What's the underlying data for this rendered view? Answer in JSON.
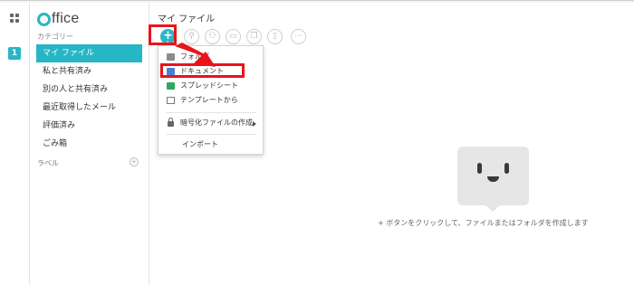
{
  "app": {
    "logo_text": "ffice"
  },
  "rail": {
    "badge": "1"
  },
  "sidebar": {
    "category_label": "カテゴリー",
    "items": [
      {
        "label": "マイ ファイル",
        "active": true
      },
      {
        "label": "私と共有済み"
      },
      {
        "label": "別の人と共有済み"
      },
      {
        "label": "最近取得したメール"
      },
      {
        "label": "評価済み"
      },
      {
        "label": "ごみ箱"
      }
    ],
    "labels_heading": "ラベル",
    "add_label_icon": "+"
  },
  "main": {
    "title": "マイ ファイル",
    "toolbar": {
      "new_icon": "+",
      "link_icon": "⚲",
      "share_icon": "⚇",
      "folder_icon": "▭",
      "copy_icon": "❐",
      "delete_icon": "▯",
      "more_icon": "⋯"
    }
  },
  "menu": {
    "items": [
      {
        "label": "フォルダ",
        "icon": "folder-icon"
      },
      {
        "label": "ドキュメント",
        "icon": "document-icon"
      },
      {
        "label": "スプレッドシート",
        "icon": "spreadsheet-icon"
      },
      {
        "label": "テンプレートから",
        "icon": "template-icon"
      },
      {
        "label": "暗号化ファイルの作成",
        "icon": "lock-icon"
      },
      {
        "label": "インポート"
      }
    ]
  },
  "empty_state": {
    "message": "+ ボタンをクリックして、ファイルまたはフォルダを作成します"
  },
  "colors": {
    "accent": "#27b6c5",
    "highlight": "#e8141b"
  }
}
